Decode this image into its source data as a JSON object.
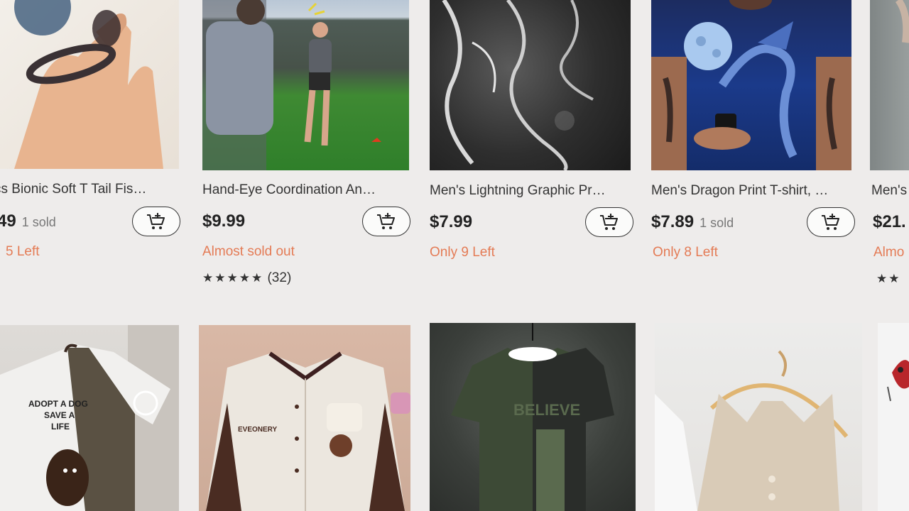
{
  "products_row1": [
    {
      "title": "cs Bionic Soft T Tail Fis…",
      "price": "49",
      "sold": "1 sold",
      "stock": "5 Left",
      "image": "ring-hand-photo"
    },
    {
      "title": "Hand-Eye Coordination An…",
      "price": "$9.99",
      "sold": "",
      "stock": "Almost sold out",
      "rating_stars": "★★★★★",
      "rating_count": "(32)",
      "image": "field-throwing-photo"
    },
    {
      "title": "Men's Lightning Graphic Pr…",
      "price": "$7.99",
      "sold": "",
      "stock": "Only 9 Left",
      "image": "lightning-shirt-photo"
    },
    {
      "title": "Men's Dragon Print T-shirt, …",
      "price": "$7.89",
      "sold": "1 sold",
      "stock": "Only 8 Left",
      "image": "dragon-shirt-photo"
    },
    {
      "title": "Men's",
      "price": "$21.",
      "stock": "Almo",
      "rating_stars": "★★",
      "image": "stone-photo"
    }
  ],
  "products_row2": [
    {
      "image": "adopt-a-dog-tee",
      "tee_text": "ADOPT A DOG\nSAVE A\nLIFE"
    },
    {
      "image": "varsity-jacket",
      "jacket_text": "EVEONERY"
    },
    {
      "image": "believe-camo-tee",
      "tee_text": "BELIEVE"
    },
    {
      "image": "crochet-vest"
    },
    {
      "image": "fishing-lure"
    }
  ],
  "icons": {
    "cart": "add-to-cart-icon",
    "star": "star-icon"
  },
  "colors": {
    "background": "#eeeceb",
    "stock_text": "#e47b55",
    "price_text": "#222222"
  }
}
